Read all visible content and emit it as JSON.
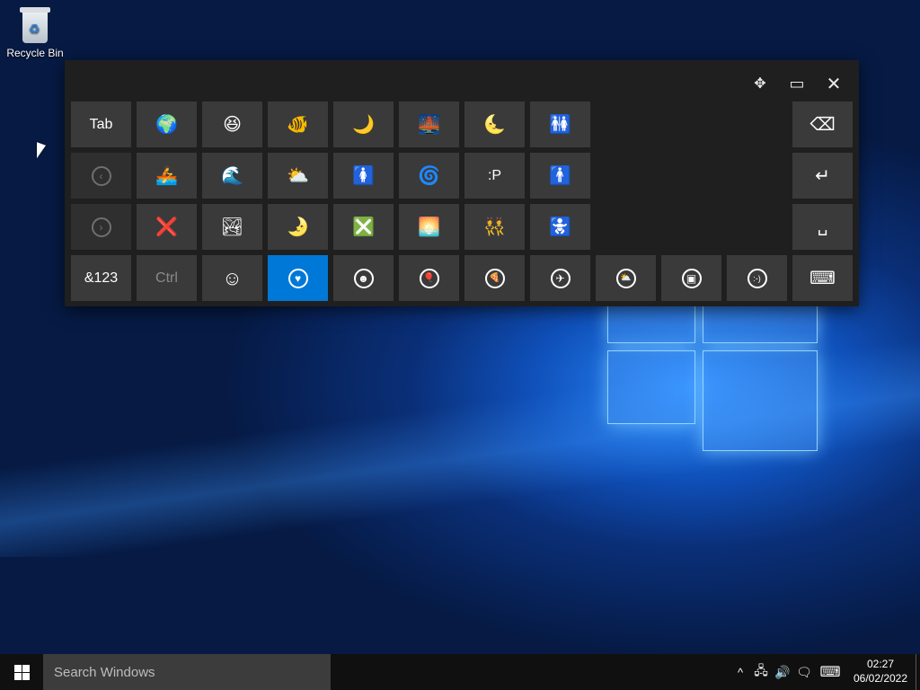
{
  "desktop": {
    "icons": [
      {
        "label": "Recycle Bin",
        "icon": "recycle-bin-icon"
      }
    ]
  },
  "keyboard": {
    "controls": {
      "move": "✥",
      "dock": "▭",
      "close": "✕"
    },
    "rows": [
      [
        {
          "name": "key-tab",
          "label": "Tab",
          "interactable": true
        },
        {
          "name": "globe-emoji-key",
          "label": "🌍"
        },
        {
          "name": "laughing-emoji-key",
          "label": "😆"
        },
        {
          "name": "fish-emoji-key",
          "label": "🐠"
        },
        {
          "name": "crescent-moon-emoji-key",
          "label": "🌙"
        },
        {
          "name": "bridge-night-emoji-key",
          "label": "🌉"
        },
        {
          "name": "moon-face-emoji-key",
          "label": "🌜"
        },
        {
          "name": "restroom-emoji-key",
          "label": "🚻"
        }
      ],
      [
        {
          "name": "prev-page-key",
          "label": "‹"
        },
        {
          "name": "rowboat-emoji-key",
          "label": "🚣"
        },
        {
          "name": "wave-emoji-key",
          "label": "🌊"
        },
        {
          "name": "sun-cloud-emoji-key",
          "label": "⛅"
        },
        {
          "name": "womens-room-emoji-key",
          "label": "🚺"
        },
        {
          "name": "cyclone-emoji-key",
          "label": "🌀"
        },
        {
          "name": "emoticon-key",
          "label": ":P"
        },
        {
          "name": "mens-room-emoji-key",
          "label": "🚹"
        }
      ],
      [
        {
          "name": "next-page-key",
          "label": "›"
        },
        {
          "name": "cross-mark-emoji-key",
          "label": "❌"
        },
        {
          "name": "landscape-emoji-key",
          "label": "🏞"
        },
        {
          "name": "first-quarter-moon-emoji-key",
          "label": "🌛"
        },
        {
          "name": "negative-cross-emoji-key",
          "label": "❎"
        },
        {
          "name": "sunrise-emoji-key",
          "label": "🌅"
        },
        {
          "name": "bunny-girl-emoji-key",
          "label": "👯"
        },
        {
          "name": "baby-symbol-emoji-key",
          "label": "🚼"
        }
      ]
    ],
    "right_keys": {
      "backspace": "⌫",
      "enter": "↵",
      "space": "␣"
    },
    "bottom_row": {
      "symbols": "&123",
      "ctrl": "Ctrl",
      "categories": [
        {
          "name": "category-smileys",
          "label": "☺"
        },
        {
          "name": "category-hearts",
          "label": "♥"
        },
        {
          "name": "category-people",
          "label": "☻"
        },
        {
          "name": "category-celebration",
          "label": "🎈"
        },
        {
          "name": "category-food",
          "label": "🍕"
        },
        {
          "name": "category-transport",
          "label": "✈"
        },
        {
          "name": "category-weather",
          "label": "⛅"
        },
        {
          "name": "category-symbols",
          "label": "▣"
        },
        {
          "name": "category-emoticons",
          "label": ":-)"
        }
      ],
      "keyboard_menu": "⌨"
    }
  },
  "taskbar": {
    "search_placeholder": "Search Windows",
    "tray": {
      "chevron": "^",
      "network": "🖧",
      "volume": "🔊",
      "action_center": "🗨",
      "touch_keyboard": "⌨"
    },
    "time": "02:27",
    "date": "06/02/2022"
  },
  "colors": {
    "accent": "#0078d7",
    "key": "#3a3a3a",
    "keyboard_bg": "#1f1f1f",
    "taskbar": "#101010"
  }
}
